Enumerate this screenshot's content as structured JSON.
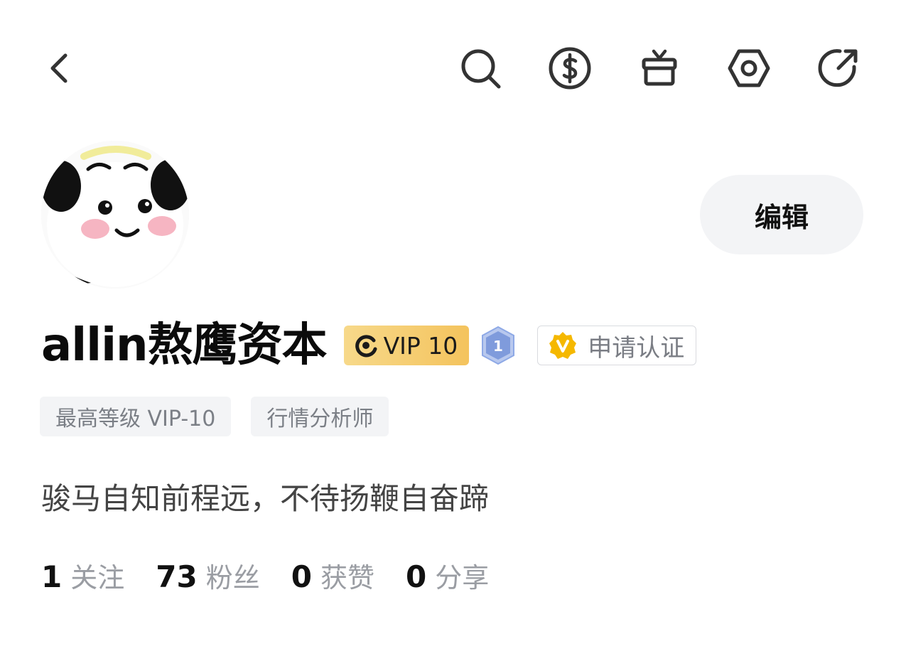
{
  "header": {
    "icons": [
      "back-icon",
      "search-icon",
      "dollar-coin-icon",
      "gift-icon",
      "settings-hexagon-icon",
      "share-arrow-icon"
    ]
  },
  "profile": {
    "username": "allin熬鹰资本",
    "edit_label": "编辑",
    "vip_badge": "VIP 10",
    "level_badge": "1",
    "certify_label": "申请认证",
    "tags": [
      "最高等级 VIP-10",
      "行情分析师"
    ],
    "bio": "骏马自知前程远，不待扬鞭自奋蹄"
  },
  "stats": [
    {
      "value": "1",
      "label": "关注"
    },
    {
      "value": "73",
      "label": "粉丝"
    },
    {
      "value": "0",
      "label": "获赞"
    },
    {
      "value": "0",
      "label": "分享"
    }
  ],
  "colors": {
    "vip_gold": "#f4c35d",
    "certify_yellow": "#f5b800",
    "level_blue": "#8ea9e6",
    "muted_text": "#9a9da3",
    "chip_bg": "#f3f4f6"
  }
}
